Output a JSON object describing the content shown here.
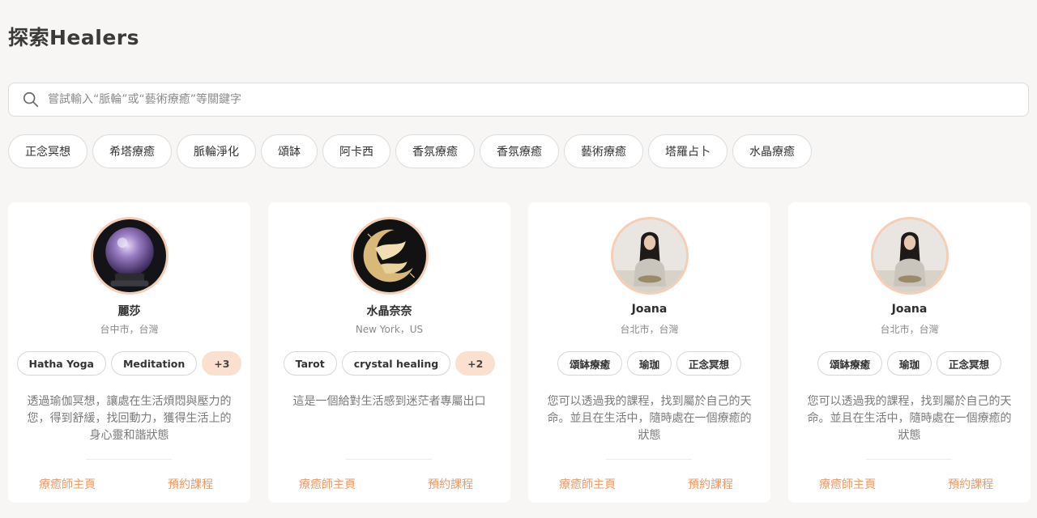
{
  "page": {
    "title": "探索Healers"
  },
  "search": {
    "placeholder": "嘗試輸入“脈輪”或“藝術療癒”等關鍵字",
    "icon": "search-icon"
  },
  "filters": [
    "正念冥想",
    "希塔療癒",
    "脈輪淨化",
    "頌缽",
    "阿卡西",
    "香氛療癒",
    "香氛療癒",
    "藝術療癒",
    "塔羅占卜",
    "水晶療癒"
  ],
  "cards": [
    {
      "name": "麗莎",
      "location": "台中市，台灣",
      "avatar": "crystal-ball-avatar",
      "tags": [
        "Hatha Yoga",
        "Meditation"
      ],
      "more": "+3",
      "description": "透過瑜伽冥想，讓處在生活煩悶與壓力的您，得到舒緩，找回動力，獲得生活上的身心靈和諧狀態",
      "profile_link": "療癒師主頁",
      "book_link": "預約課程"
    },
    {
      "name": "水晶奈奈",
      "location": "New York，US",
      "avatar": "golden-moon-avatar",
      "tags": [
        "Tarot",
        "crystal healing"
      ],
      "more": "+2",
      "description": "這是一個給對生活感到迷茫者專屬出口",
      "profile_link": "療癒師主頁",
      "book_link": "預約課程"
    },
    {
      "name": "Joana",
      "location": "台北市，台灣",
      "avatar": "woman-portrait-avatar",
      "tags": [
        "頌缽療癒",
        "瑜珈",
        "正念冥想"
      ],
      "more": "",
      "description": "您可以透過我的課程，找到屬於自己的天命。並且在生活中，隨時處在一個療癒的狀態",
      "profile_link": "療癒師主頁",
      "book_link": "預約課程"
    },
    {
      "name": "Joana",
      "location": "台北市，台灣",
      "avatar": "woman-portrait-avatar",
      "tags": [
        "頌缽療癒",
        "瑜珈",
        "正念冥想"
      ],
      "more": "",
      "description": "您可以透過我的課程，找到屬於自己的天命。並且在生活中，隨時處在一個療癒的狀態",
      "profile_link": "療癒師主頁",
      "book_link": "預約課程"
    }
  ],
  "colors": {
    "accent": "#ec9a66",
    "more_badge": "#fbe0cf",
    "avatar_ring": "#f6cdb5",
    "background": "#f7f6f5"
  }
}
